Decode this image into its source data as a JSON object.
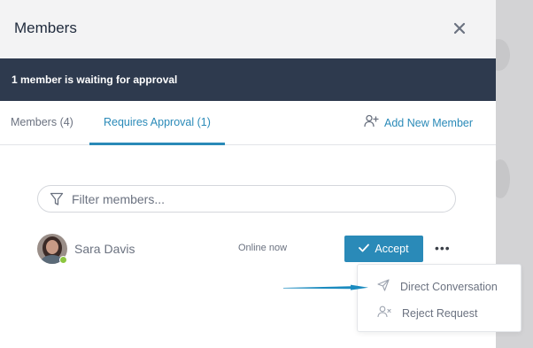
{
  "header": {
    "title": "Members"
  },
  "banner": {
    "text": "1 member is waiting for approval"
  },
  "tabs": [
    {
      "label": "Members (4)",
      "active": false
    },
    {
      "label": "Requires Approval (1)",
      "active": true
    }
  ],
  "add_member": {
    "label": "Add New Member",
    "icon": "add-user-icon"
  },
  "filter": {
    "placeholder": "Filter members...",
    "value": "",
    "icon": "filter-icon"
  },
  "member": {
    "name": "Sara Davis",
    "status": "Online now",
    "presence": "online"
  },
  "actions": {
    "accept_label": "Accept",
    "more_label": "•••"
  },
  "menu": {
    "items": [
      {
        "label": "Direct Conversation",
        "icon": "send-icon"
      },
      {
        "label": "Reject Request",
        "icon": "remove-user-icon"
      }
    ]
  },
  "colors": {
    "accent": "#2a8ab8",
    "banner": "#2e3a4e",
    "presence": "#8cc63f",
    "pointer_arrow": "#1b8bbf"
  }
}
